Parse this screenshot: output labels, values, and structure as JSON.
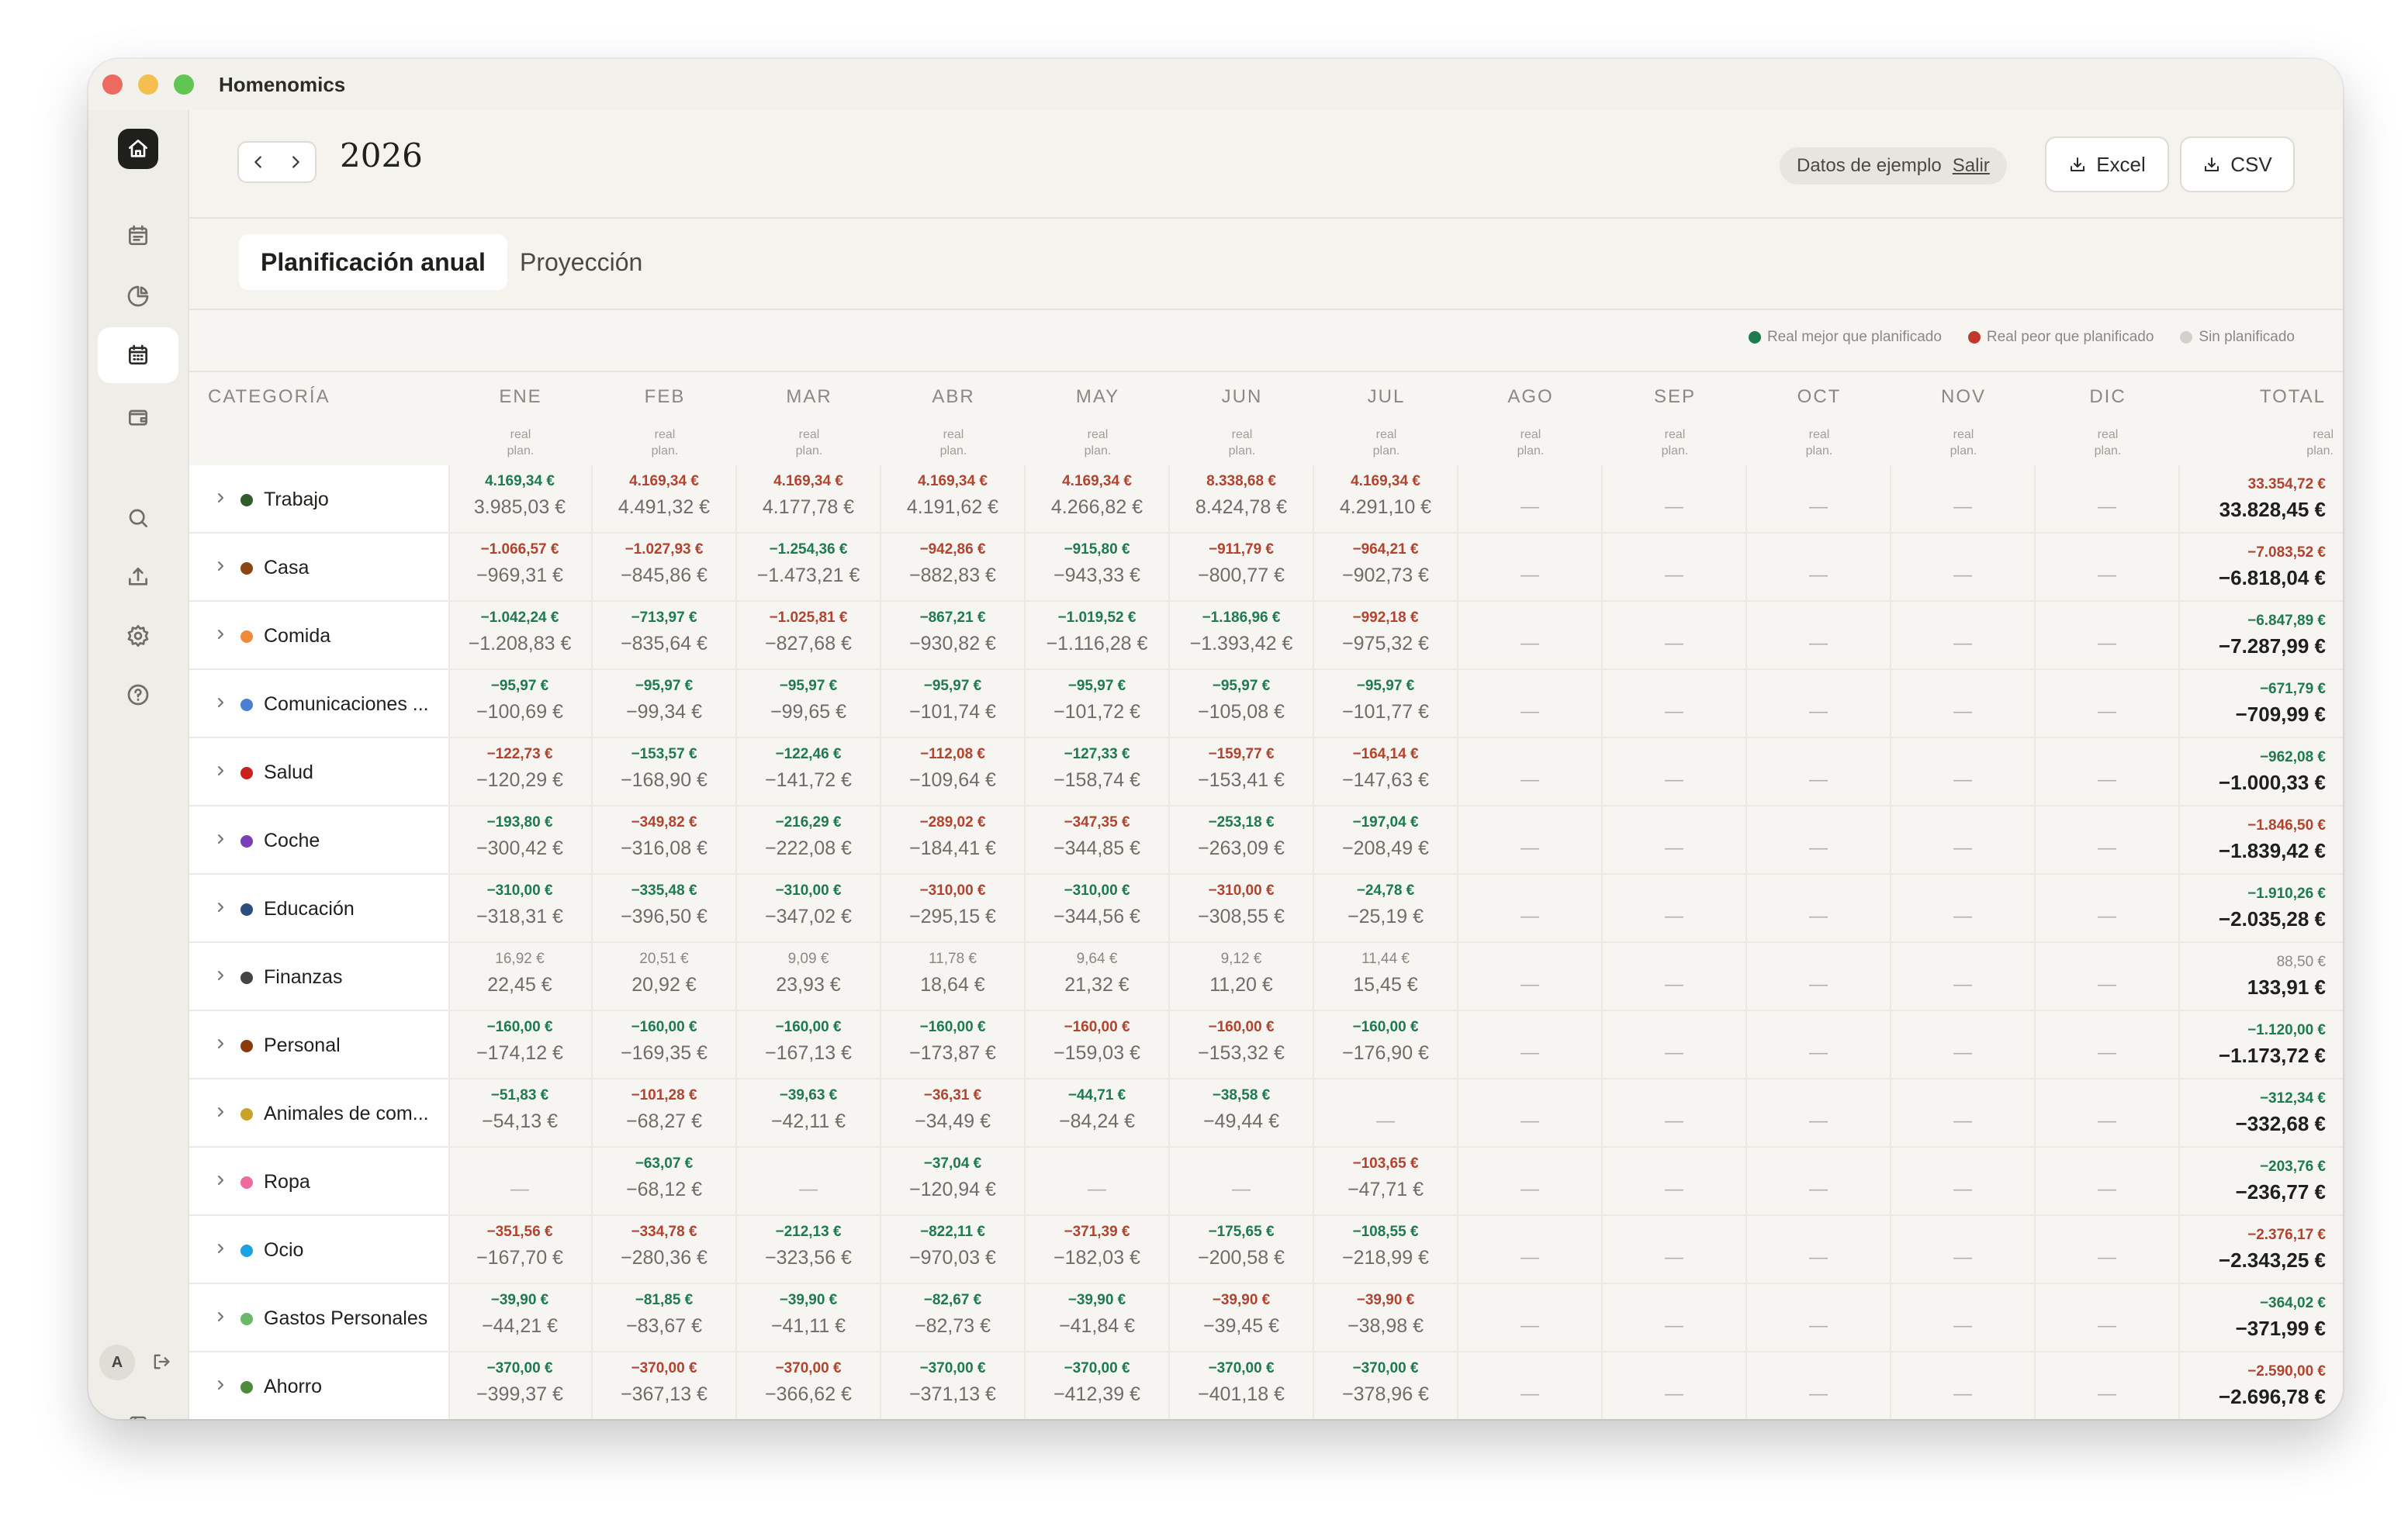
{
  "app": {
    "title": "Homenomics"
  },
  "toolbar": {
    "year": "2026",
    "sample_label": "Datos de ejemplo",
    "sample_exit": "Salir",
    "excel_label": "Excel",
    "csv_label": "CSV"
  },
  "tabs": [
    {
      "label": "Planificación anual",
      "active": true
    },
    {
      "label": "Proyección",
      "active": false
    }
  ],
  "legend": [
    {
      "label": "Real mejor que planificado",
      "color": "#1e7a4f"
    },
    {
      "label": "Real peor que planificado",
      "color": "#c0392b"
    },
    {
      "label": "Sin planificado",
      "color": "#d2d0ca"
    }
  ],
  "sidebar": {
    "avatar_initial": "A"
  },
  "table": {
    "category_header": "CATEGORÍA",
    "months": [
      "ENE",
      "FEB",
      "MAR",
      "ABR",
      "MAY",
      "JUN",
      "JUL",
      "AGO",
      "SEP",
      "OCT",
      "NOV",
      "DIC"
    ],
    "total_header": "TOTAL",
    "sub_real": "real",
    "sub_plan": "plan.",
    "empty_value": "—",
    "rows": [
      {
        "name": "Trabajo",
        "color": "#2f5e2b",
        "cells": [
          [
            "4.169,34 €",
            "3.985,03 €",
            "good"
          ],
          [
            "4.169,34 €",
            "4.491,32 €",
            "bad"
          ],
          [
            "4.169,34 €",
            "4.177,78 €",
            "bad"
          ],
          [
            "4.169,34 €",
            "4.191,62 €",
            "bad"
          ],
          [
            "4.169,34 €",
            "4.266,82 €",
            "bad"
          ],
          [
            "8.338,68 €",
            "8.424,78 €",
            "bad"
          ],
          [
            "4.169,34 €",
            "4.291,10 €",
            "bad"
          ],
          [
            "",
            "",
            ""
          ],
          [
            "",
            "",
            ""
          ],
          [
            "",
            "",
            ""
          ],
          [
            "",
            "",
            ""
          ],
          [
            "",
            "",
            ""
          ]
        ],
        "total": [
          "33.354,72 €",
          "33.828,45 €",
          "bad"
        ]
      },
      {
        "name": "Casa",
        "color": "#8b4513",
        "cells": [
          [
            "−1.066,57 €",
            "−969,31 €",
            "bad"
          ],
          [
            "−1.027,93 €",
            "−845,86 €",
            "bad"
          ],
          [
            "−1.254,36 €",
            "−1.473,21 €",
            "good"
          ],
          [
            "−942,86 €",
            "−882,83 €",
            "bad"
          ],
          [
            "−915,80 €",
            "−943,33 €",
            "good"
          ],
          [
            "−911,79 €",
            "−800,77 €",
            "bad"
          ],
          [
            "−964,21 €",
            "−902,73 €",
            "bad"
          ],
          [
            "",
            "",
            ""
          ],
          [
            "",
            "",
            ""
          ],
          [
            "",
            "",
            ""
          ],
          [
            "",
            "",
            ""
          ],
          [
            "",
            "",
            ""
          ]
        ],
        "total": [
          "−7.083,52 €",
          "−6.818,04 €",
          "bad"
        ]
      },
      {
        "name": "Comida",
        "color": "#f08a3c",
        "cells": [
          [
            "−1.042,24 €",
            "−1.208,83 €",
            "good"
          ],
          [
            "−713,97 €",
            "−835,64 €",
            "good"
          ],
          [
            "−1.025,81 €",
            "−827,68 €",
            "bad"
          ],
          [
            "−867,21 €",
            "−930,82 €",
            "good"
          ],
          [
            "−1.019,52 €",
            "−1.116,28 €",
            "good"
          ],
          [
            "−1.186,96 €",
            "−1.393,42 €",
            "good"
          ],
          [
            "−992,18 €",
            "−975,32 €",
            "bad"
          ],
          [
            "",
            "",
            ""
          ],
          [
            "",
            "",
            ""
          ],
          [
            "",
            "",
            ""
          ],
          [
            "",
            "",
            ""
          ],
          [
            "",
            "",
            ""
          ]
        ],
        "total": [
          "−6.847,89 €",
          "−7.287,99 €",
          "good"
        ]
      },
      {
        "name": "Comunicaciones ...",
        "color": "#4a7fd4",
        "cells": [
          [
            "−95,97 €",
            "−100,69 €",
            "good"
          ],
          [
            "−95,97 €",
            "−99,34 €",
            "good"
          ],
          [
            "−95,97 €",
            "−99,65 €",
            "good"
          ],
          [
            "−95,97 €",
            "−101,74 €",
            "good"
          ],
          [
            "−95,97 €",
            "−101,72 €",
            "good"
          ],
          [
            "−95,97 €",
            "−105,08 €",
            "good"
          ],
          [
            "−95,97 €",
            "−101,77 €",
            "good"
          ],
          [
            "",
            "",
            ""
          ],
          [
            "",
            "",
            ""
          ],
          [
            "",
            "",
            ""
          ],
          [
            "",
            "",
            ""
          ],
          [
            "",
            "",
            ""
          ]
        ],
        "total": [
          "−671,79 €",
          "−709,99 €",
          "good"
        ]
      },
      {
        "name": "Salud",
        "color": "#cc1f1f",
        "cells": [
          [
            "−122,73 €",
            "−120,29 €",
            "bad"
          ],
          [
            "−153,57 €",
            "−168,90 €",
            "good"
          ],
          [
            "−122,46 €",
            "−141,72 €",
            "good"
          ],
          [
            "−112,08 €",
            "−109,64 €",
            "bad"
          ],
          [
            "−127,33 €",
            "−158,74 €",
            "good"
          ],
          [
            "−159,77 €",
            "−153,41 €",
            "bad"
          ],
          [
            "−164,14 €",
            "−147,63 €",
            "bad"
          ],
          [
            "",
            "",
            ""
          ],
          [
            "",
            "",
            ""
          ],
          [
            "",
            "",
            ""
          ],
          [
            "",
            "",
            ""
          ],
          [
            "",
            "",
            ""
          ]
        ],
        "total": [
          "−962,08 €",
          "−1.000,33 €",
          "good"
        ]
      },
      {
        "name": "Coche",
        "color": "#7b3fb5",
        "cells": [
          [
            "−193,80 €",
            "−300,42 €",
            "good"
          ],
          [
            "−349,82 €",
            "−316,08 €",
            "bad"
          ],
          [
            "−216,29 €",
            "−222,08 €",
            "good"
          ],
          [
            "−289,02 €",
            "−184,41 €",
            "bad"
          ],
          [
            "−347,35 €",
            "−344,85 €",
            "bad"
          ],
          [
            "−253,18 €",
            "−263,09 €",
            "good"
          ],
          [
            "−197,04 €",
            "−208,49 €",
            "good"
          ],
          [
            "",
            "",
            ""
          ],
          [
            "",
            "",
            ""
          ],
          [
            "",
            "",
            ""
          ],
          [
            "",
            "",
            ""
          ],
          [
            "",
            "",
            ""
          ]
        ],
        "total": [
          "−1.846,50 €",
          "−1.839,42 €",
          "bad"
        ]
      },
      {
        "name": "Educación",
        "color": "#2a4f7f",
        "cells": [
          [
            "−310,00 €",
            "−318,31 €",
            "good"
          ],
          [
            "−335,48 €",
            "−396,50 €",
            "good"
          ],
          [
            "−310,00 €",
            "−347,02 €",
            "good"
          ],
          [
            "−310,00 €",
            "−295,15 €",
            "bad"
          ],
          [
            "−310,00 €",
            "−344,56 €",
            "good"
          ],
          [
            "−310,00 €",
            "−308,55 €",
            "bad"
          ],
          [
            "−24,78 €",
            "−25,19 €",
            "good"
          ],
          [
            "",
            "",
            ""
          ],
          [
            "",
            "",
            ""
          ],
          [
            "",
            "",
            ""
          ],
          [
            "",
            "",
            ""
          ],
          [
            "",
            "",
            ""
          ]
        ],
        "total": [
          "−1.910,26 €",
          "−2.035,28 €",
          "good"
        ]
      },
      {
        "name": "Finanzas",
        "color": "#444444",
        "cells": [
          [
            "16,92 €",
            "22,45 €",
            "neutral"
          ],
          [
            "20,51 €",
            "20,92 €",
            "neutral"
          ],
          [
            "9,09 €",
            "23,93 €",
            "neutral"
          ],
          [
            "11,78 €",
            "18,64 €",
            "neutral"
          ],
          [
            "9,64 €",
            "21,32 €",
            "neutral"
          ],
          [
            "9,12 €",
            "11,20 €",
            "neutral"
          ],
          [
            "11,44 €",
            "15,45 €",
            "neutral"
          ],
          [
            "",
            "",
            ""
          ],
          [
            "",
            "",
            ""
          ],
          [
            "",
            "",
            ""
          ],
          [
            "",
            "",
            ""
          ],
          [
            "",
            "",
            ""
          ]
        ],
        "total": [
          "88,50 €",
          "133,91 €",
          "neutral"
        ]
      },
      {
        "name": "Personal",
        "color": "#8b3a0f",
        "cells": [
          [
            "−160,00 €",
            "−174,12 €",
            "good"
          ],
          [
            "−160,00 €",
            "−169,35 €",
            "good"
          ],
          [
            "−160,00 €",
            "−167,13 €",
            "good"
          ],
          [
            "−160,00 €",
            "−173,87 €",
            "good"
          ],
          [
            "−160,00 €",
            "−159,03 €",
            "bad"
          ],
          [
            "−160,00 €",
            "−153,32 €",
            "bad"
          ],
          [
            "−160,00 €",
            "−176,90 €",
            "good"
          ],
          [
            "",
            "",
            ""
          ],
          [
            "",
            "",
            ""
          ],
          [
            "",
            "",
            ""
          ],
          [
            "",
            "",
            ""
          ],
          [
            "",
            "",
            ""
          ]
        ],
        "total": [
          "−1.120,00 €",
          "−1.173,72 €",
          "good"
        ]
      },
      {
        "name": "Animales de com...",
        "color": "#c9a227",
        "cells": [
          [
            "−51,83 €",
            "−54,13 €",
            "good"
          ],
          [
            "−101,28 €",
            "−68,27 €",
            "bad"
          ],
          [
            "−39,63 €",
            "−42,11 €",
            "good"
          ],
          [
            "−36,31 €",
            "−34,49 €",
            "bad"
          ],
          [
            "−44,71 €",
            "−84,24 €",
            "good"
          ],
          [
            "−38,58 €",
            "−49,44 €",
            "good"
          ],
          [
            "",
            "",
            ""
          ],
          [
            "",
            "",
            ""
          ],
          [
            "",
            "",
            ""
          ],
          [
            "",
            "",
            ""
          ],
          [
            "",
            "",
            ""
          ],
          [
            "",
            "",
            ""
          ]
        ],
        "total": [
          "−312,34 €",
          "−332,68 €",
          "good"
        ]
      },
      {
        "name": "Ropa",
        "color": "#f06aa0",
        "cells": [
          [
            "",
            "",
            ""
          ],
          [
            "−63,07 €",
            "−68,12 €",
            "good"
          ],
          [
            "",
            "",
            ""
          ],
          [
            "−37,04 €",
            "−120,94 €",
            "good"
          ],
          [
            "",
            "",
            ""
          ],
          [
            "",
            "",
            ""
          ],
          [
            "−103,65 €",
            "−47,71 €",
            "bad"
          ],
          [
            "",
            "",
            ""
          ],
          [
            "",
            "",
            ""
          ],
          [
            "",
            "",
            ""
          ],
          [
            "",
            "",
            ""
          ],
          [
            "",
            "",
            ""
          ]
        ],
        "total": [
          "−203,76 €",
          "−236,77 €",
          "good"
        ]
      },
      {
        "name": "Ocio",
        "color": "#1aa3e0",
        "cells": [
          [
            "−351,56 €",
            "−167,70 €",
            "bad"
          ],
          [
            "−334,78 €",
            "−280,36 €",
            "bad"
          ],
          [
            "−212,13 €",
            "−323,56 €",
            "good"
          ],
          [
            "−822,11 €",
            "−970,03 €",
            "good"
          ],
          [
            "−371,39 €",
            "−182,03 €",
            "bad"
          ],
          [
            "−175,65 €",
            "−200,58 €",
            "good"
          ],
          [
            "−108,55 €",
            "−218,99 €",
            "good"
          ],
          [
            "",
            "",
            ""
          ],
          [
            "",
            "",
            ""
          ],
          [
            "",
            "",
            ""
          ],
          [
            "",
            "",
            ""
          ],
          [
            "",
            "",
            ""
          ]
        ],
        "total": [
          "−2.376,17 €",
          "−2.343,25 €",
          "bad"
        ]
      },
      {
        "name": "Gastos Personales",
        "color": "#6bb86b",
        "cells": [
          [
            "−39,90 €",
            "−44,21 €",
            "good"
          ],
          [
            "−81,85 €",
            "−83,67 €",
            "good"
          ],
          [
            "−39,90 €",
            "−41,11 €",
            "good"
          ],
          [
            "−82,67 €",
            "−82,73 €",
            "good"
          ],
          [
            "−39,90 €",
            "−41,84 €",
            "good"
          ],
          [
            "−39,90 €",
            "−39,45 €",
            "bad"
          ],
          [
            "−39,90 €",
            "−38,98 €",
            "bad"
          ],
          [
            "",
            "",
            ""
          ],
          [
            "",
            "",
            ""
          ],
          [
            "",
            "",
            ""
          ],
          [
            "",
            "",
            ""
          ],
          [
            "",
            "",
            ""
          ]
        ],
        "total": [
          "−364,02 €",
          "−371,99 €",
          "good"
        ]
      },
      {
        "name": "Ahorro",
        "color": "#4e8a3c",
        "cells": [
          [
            "−370,00 €",
            "−399,37 €",
            "good"
          ],
          [
            "−370,00 €",
            "−367,13 €",
            "bad"
          ],
          [
            "−370,00 €",
            "−366,62 €",
            "bad"
          ],
          [
            "−370,00 €",
            "−371,13 €",
            "good"
          ],
          [
            "−370,00 €",
            "−412,39 €",
            "good"
          ],
          [
            "−370,00 €",
            "−401,18 €",
            "good"
          ],
          [
            "−370,00 €",
            "−378,96 €",
            "good"
          ],
          [
            "",
            "",
            ""
          ],
          [
            "",
            "",
            ""
          ],
          [
            "",
            "",
            ""
          ],
          [
            "",
            "",
            ""
          ],
          [
            "",
            "",
            ""
          ]
        ],
        "total": [
          "−2.590,00 €",
          "−2.696,78 €",
          "bad"
        ]
      }
    ]
  }
}
